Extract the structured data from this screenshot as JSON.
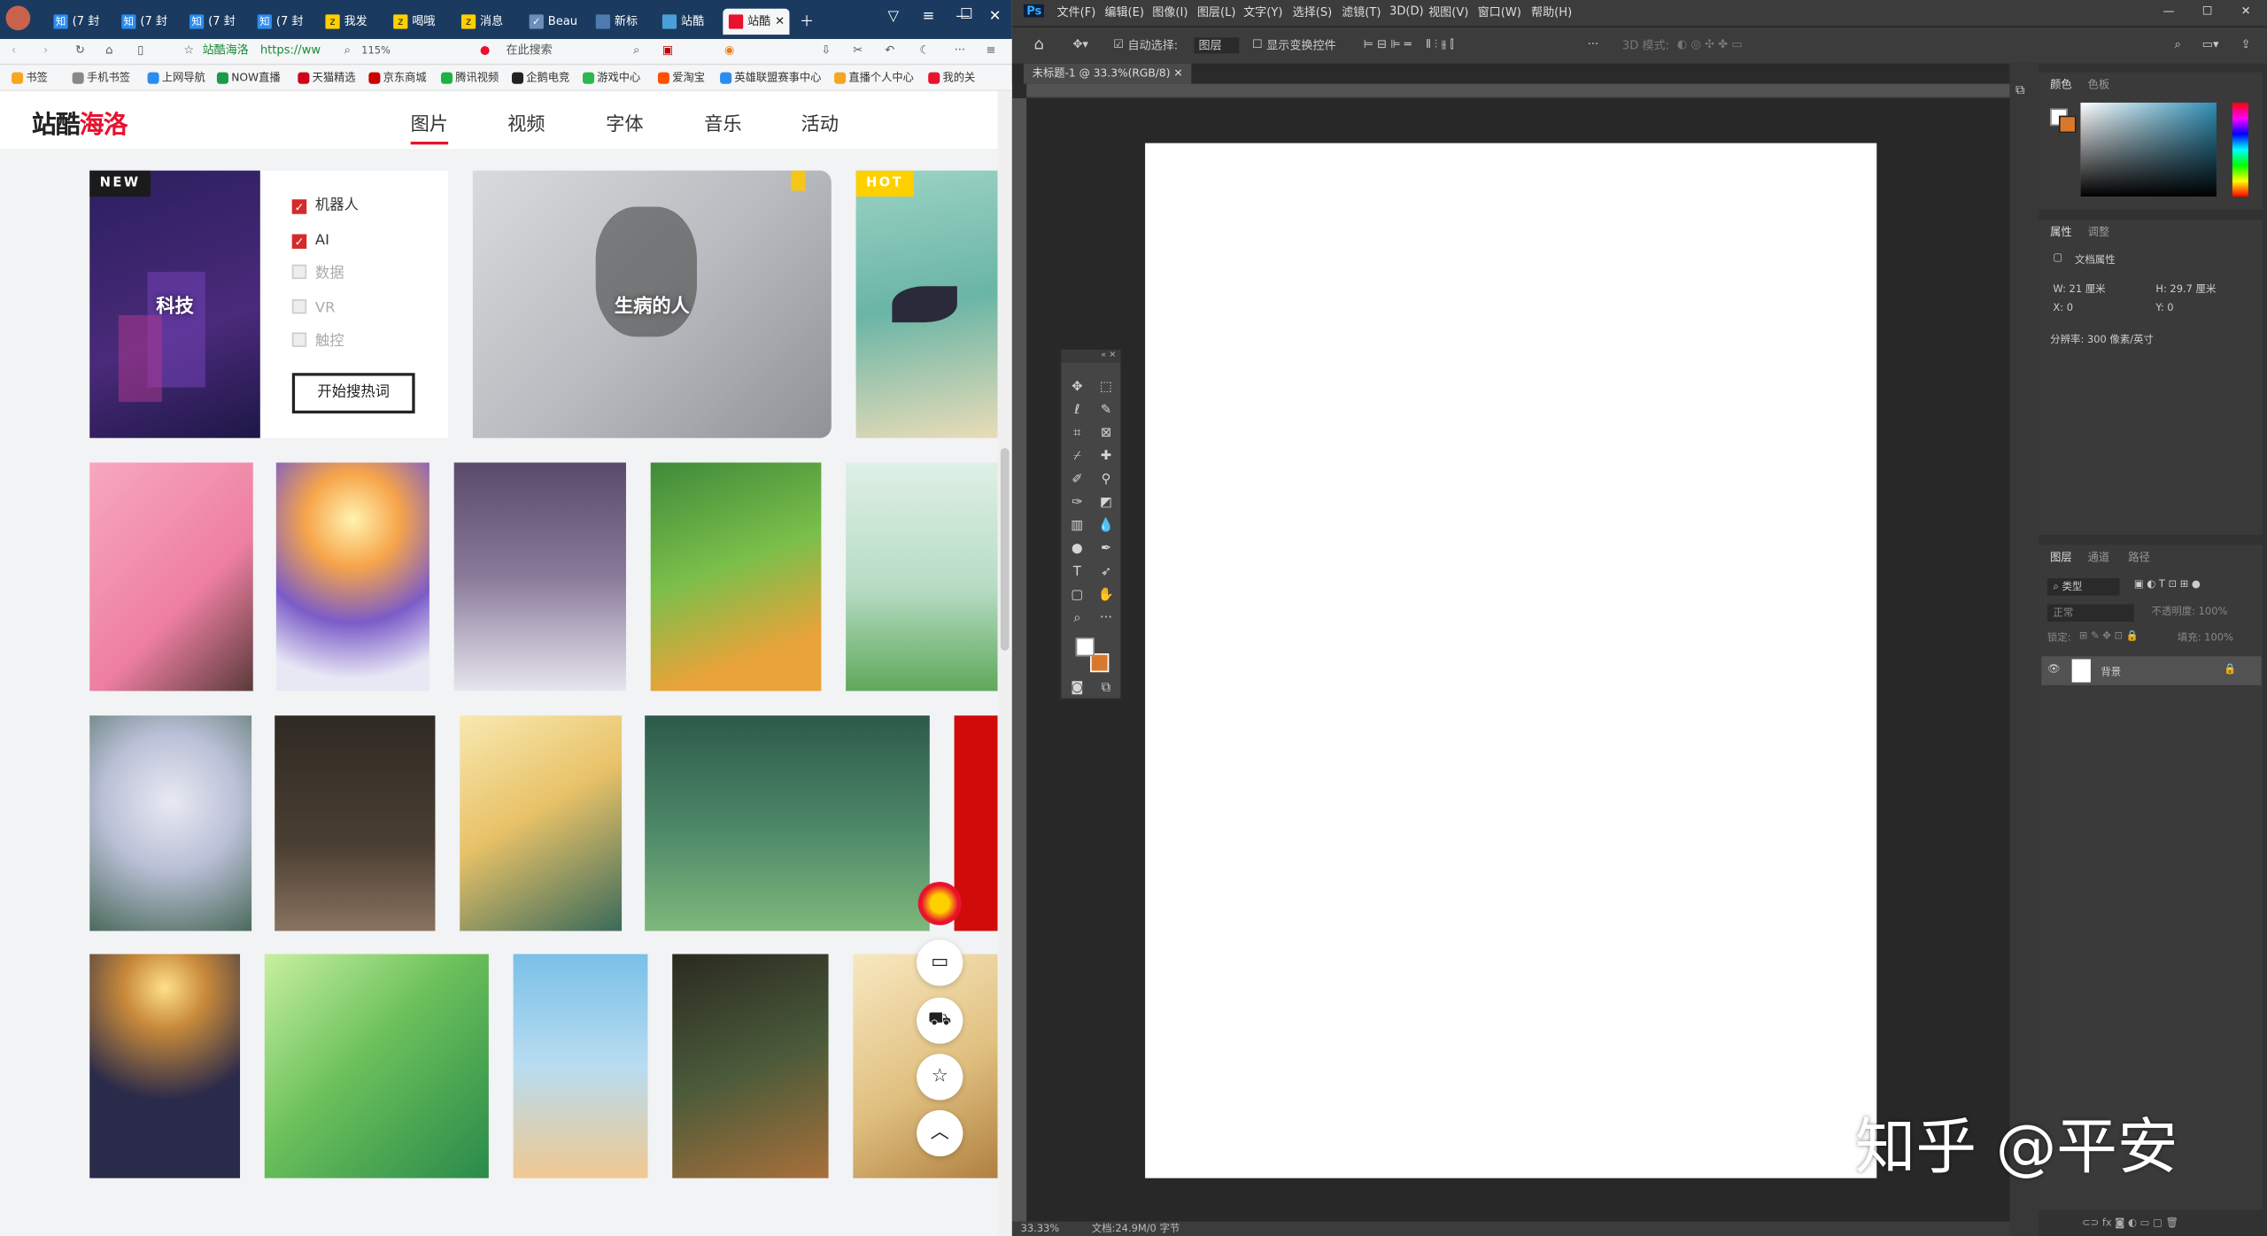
{
  "browser": {
    "tabs": [
      "(7 封",
      "(7 封",
      "(7 封",
      "(7 封",
      "我发",
      "喝哦",
      "消息",
      "Beau",
      "新标",
      "站酷",
      "站酷"
    ],
    "address": "https://ww",
    "zoom": "115%",
    "search_placeholder": "在此搜索",
    "bookmarks": [
      "书签",
      "手机书签",
      "上网导航",
      "NOW直播",
      "天猫精选",
      "京东商城",
      "腾讯视频",
      "企鹅电竞",
      "游戏中心",
      "爱淘宝",
      "英雄联盟赛事中心",
      "直播个人中心",
      "我的关"
    ]
  },
  "site": {
    "logo_main": "站酷",
    "logo_accent": "海洛",
    "nav": [
      "图片",
      "视频",
      "字体",
      "音乐",
      "活动"
    ],
    "cards": {
      "tech": {
        "title": "科技",
        "badge": "NEW"
      },
      "sick": {
        "title": "生病的人"
      },
      "hot_badge": "HOT"
    },
    "filters": [
      {
        "label": "机器人",
        "checked": true
      },
      {
        "label": "AI",
        "checked": true
      },
      {
        "label": "数据",
        "checked": false
      },
      {
        "label": "VR",
        "checked": false
      },
      {
        "label": "触控",
        "checked": false
      }
    ],
    "search_button": "开始搜热词"
  },
  "ps": {
    "menu": [
      "文件(F)",
      "编辑(E)",
      "图像(I)",
      "图层(L)",
      "文字(Y)",
      "选择(S)",
      "滤镜(T)",
      "3D(D)",
      "视图(V)",
      "窗口(W)",
      "帮助(H)"
    ],
    "options": {
      "auto_select": "自动选择:",
      "layer": "图层",
      "transform": "显示变换控件",
      "mode3d": "3D 模式:"
    },
    "doc_tab": "未标题-1 @ 33.3%(RGB/8)",
    "status_zoom": "33.33%",
    "status_doc": "文档:24.9M/0 字节",
    "panels": {
      "color_tabs": [
        "颜色",
        "色板"
      ],
      "props_tabs": [
        "属性",
        "调整"
      ],
      "doc_props": "文档属性",
      "width": "W: 21 厘米",
      "height": "H: 29.7 厘米",
      "x": "X: 0",
      "y": "Y: 0",
      "resolution": "分辨率: 300 像素/英寸",
      "layer_tabs": [
        "图层",
        "通道",
        "路径"
      ],
      "kind": "类型",
      "blend": "正常",
      "opacity": "不透明度: 100%",
      "lock": "锁定:",
      "fill": "填充: 100%",
      "layer_name": "背景"
    },
    "colors": {
      "foreground": "#ffffff",
      "background": "#d9782a"
    }
  },
  "watermark": "知乎 @平安"
}
